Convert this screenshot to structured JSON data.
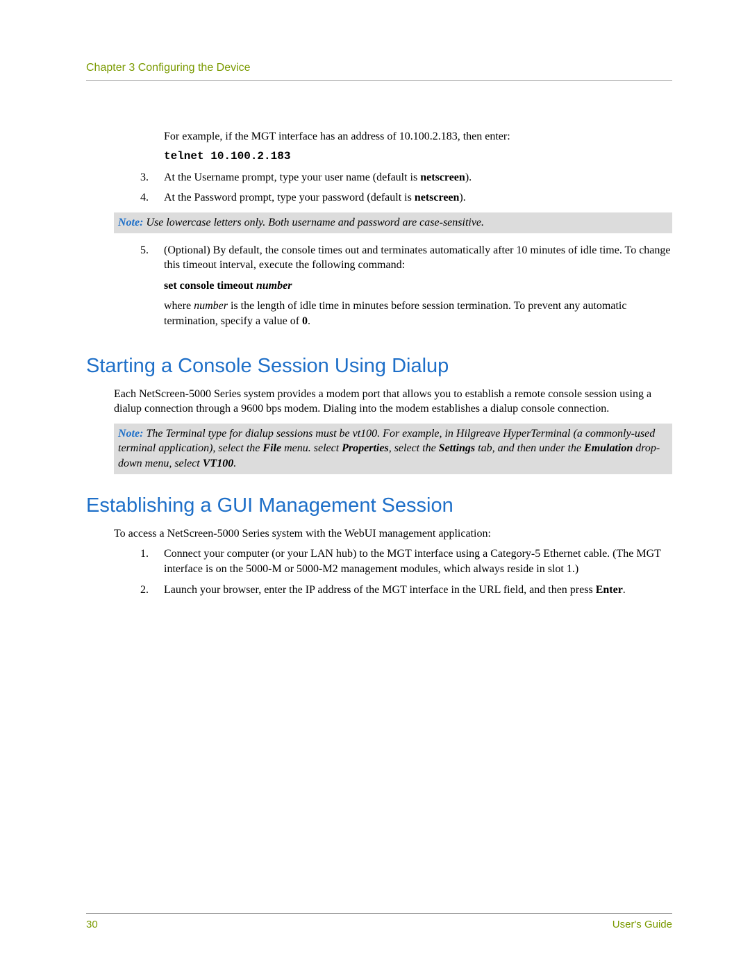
{
  "header": {
    "chapter": "Chapter 3 Configuring the Device"
  },
  "intro": {
    "example_pre": "For example, if the MGT interface has an address of 10.100.2.183, then enter:",
    "telnet_cmd": "telnet 10.100.2.183"
  },
  "steps_a": {
    "s3": {
      "num": "3.",
      "pre": "At the Username prompt, type your user name (default is ",
      "bold": "netscreen",
      "post": ")."
    },
    "s4": {
      "num": "4.",
      "pre": "At the Password prompt, type your password (default is ",
      "bold": "netscreen",
      "post": ")."
    }
  },
  "note1": {
    "label": "Note:",
    "text": " Use lowercase letters only. Both username and password are case-sensitive."
  },
  "steps_b": {
    "s5": {
      "num": "5.",
      "text": "(Optional) By default, the console times out and terminates automatically after 10 minutes of idle time. To change this timeout interval, execute the following command:",
      "cmd_bold": "set console timeout ",
      "cmd_ital": "number",
      "where_pre": "where ",
      "where_ital": "number",
      "where_mid": " is the length of idle time in minutes before session termination. To prevent any automatic termination, specify a value of ",
      "where_bold": "0",
      "where_post": "."
    }
  },
  "section1": {
    "title": "Starting a Console Session Using Dialup",
    "para": "Each NetScreen-5000 Series system provides a modem port that allows you to establish a remote console session using a dialup connection through a 9600 bps modem. Dialing into the modem establishes a dialup console connection."
  },
  "note2": {
    "label": "Note:",
    "t1": " The Terminal type for dialup sessions must be vt100. For example, in Hilgreave HyperTerminal (a commonly-used terminal application), select the ",
    "b1": "File",
    "t2": " menu. select ",
    "b2": "Properties",
    "t3": ", select the ",
    "b3": "Settings",
    "t4": " tab, and then under the ",
    "b4": "Emulation",
    "t5": " drop-down menu, select ",
    "b5": "VT100",
    "t6": "."
  },
  "section2": {
    "title": "Establishing a GUI Management Session",
    "para": "To access a NetScreen-5000 Series system with the WebUI management application:"
  },
  "steps_c": {
    "s1": {
      "num": "1.",
      "text": "Connect your computer (or your LAN hub) to the MGT interface using a Category-5 Ethernet cable. (The MGT interface is on the 5000-M or 5000-M2 management modules, which always reside in slot 1.)"
    },
    "s2": {
      "num": "2.",
      "pre": "Launch your browser, enter the IP address of the MGT interface in the URL field, and then press ",
      "bold": "Enter",
      "post": "."
    }
  },
  "footer": {
    "page": "30",
    "guide": "User's Guide"
  }
}
